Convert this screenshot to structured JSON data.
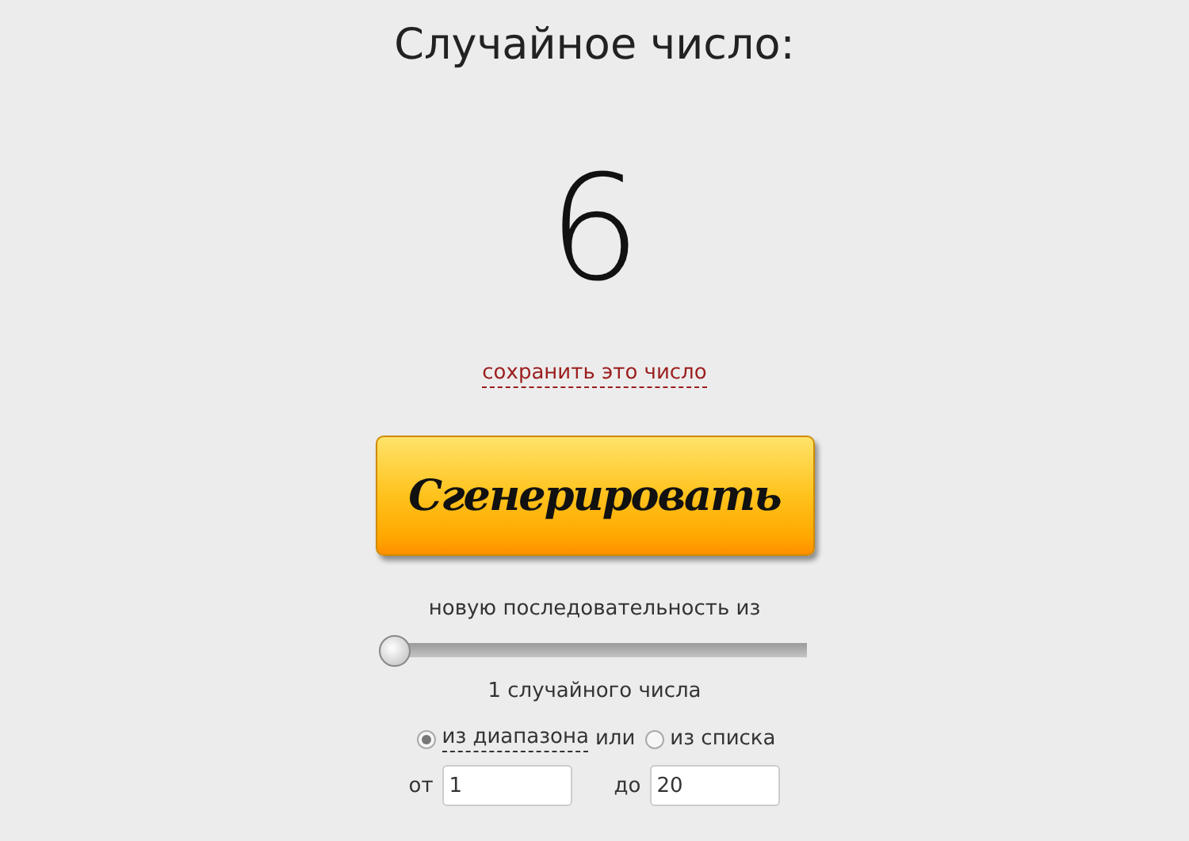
{
  "title": "Случайное число:",
  "result": "6",
  "save_link": "сохранить это число",
  "generate_button": "Сгенерировать",
  "sequence_label": "новую последовательность из",
  "count_slider": {
    "level": 0
  },
  "count_text": "1 случайного числа",
  "sources": [
    {
      "label": "из диапазона",
      "selected": true
    },
    {
      "label": "из списка",
      "selected": false
    }
  ],
  "sources_connector": "или",
  "range": {
    "from_label": "от",
    "from_value": "1",
    "to_label": "до",
    "to_value": "20"
  }
}
